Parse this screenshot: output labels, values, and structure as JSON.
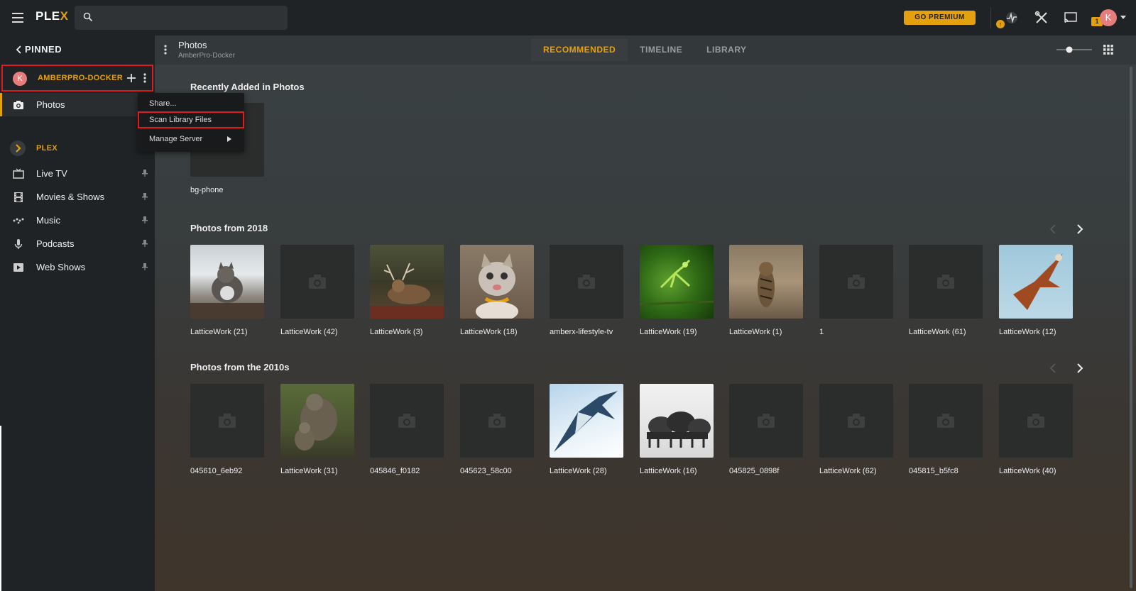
{
  "topbar": {
    "logo_main": "PLE",
    "logo_x": "X",
    "search_value": "",
    "search_placeholder": "",
    "premium_label": "GO PREMIUM",
    "notification_count": "1",
    "avatar_letter": "K",
    "brand_color": "#e5a00d",
    "icons": [
      "menu-icon",
      "search-icon",
      "activity-icon",
      "settings-icon",
      "cast-icon",
      "chevron-down-icon"
    ]
  },
  "sidebar": {
    "pinned_label": "PINNED",
    "server": {
      "avatar_letter": "K",
      "name": "AMBERPRO-DOCKER"
    },
    "libraries": [
      {
        "label": "Photos",
        "icon": "camera-icon",
        "active": true
      }
    ],
    "plex_label": "PLEX",
    "items": [
      {
        "label": "Live TV",
        "icon": "tv-icon"
      },
      {
        "label": "Movies & Shows",
        "icon": "film-icon"
      },
      {
        "label": "Music",
        "icon": "music-icon"
      },
      {
        "label": "Podcasts",
        "icon": "microphone-icon"
      },
      {
        "label": "Web Shows",
        "icon": "play-icon"
      }
    ]
  },
  "context_menu": {
    "items": [
      {
        "label": "Share..."
      },
      {
        "label": "Scan Library Files",
        "highlighted": true
      },
      {
        "label": "Manage Server",
        "has_submenu": true
      }
    ]
  },
  "main": {
    "header": {
      "title": "Photos",
      "subtitle": "AmberPro-Docker"
    },
    "tabs": [
      {
        "label": "RECOMMENDED",
        "active": true
      },
      {
        "label": "TIMELINE",
        "active": false
      },
      {
        "label": "LIBRARY",
        "active": false
      }
    ],
    "sections": [
      {
        "title": "Recently Added in Photos",
        "items": [
          {
            "label": "bg-phone",
            "image": "placeholder"
          }
        ]
      },
      {
        "title": "Photos from 2018",
        "items": [
          {
            "label": "LatticeWork (21)",
            "image": "cat-in-snow"
          },
          {
            "label": "LatticeWork (42)",
            "image": "placeholder"
          },
          {
            "label": "LatticeWork (3)",
            "image": "deer"
          },
          {
            "label": "LatticeWork (18)",
            "image": "kitten"
          },
          {
            "label": "amberx-lifestyle-tv",
            "image": "placeholder"
          },
          {
            "label": "LatticeWork (19)",
            "image": "mantis"
          },
          {
            "label": "LatticeWork (1)",
            "image": "tiger"
          },
          {
            "label": "1",
            "image": "placeholder"
          },
          {
            "label": "LatticeWork (61)",
            "image": "placeholder"
          },
          {
            "label": "LatticeWork (12)",
            "image": "kite-bird"
          }
        ]
      },
      {
        "title": "Photos from the 2010s",
        "items": [
          {
            "label": "045610_6eb92",
            "image": "placeholder"
          },
          {
            "label": "LatticeWork (31)",
            "image": "bears"
          },
          {
            "label": "045846_f0182",
            "image": "placeholder"
          },
          {
            "label": "045623_58c00",
            "image": "placeholder"
          },
          {
            "label": "LatticeWork (28)",
            "image": "shark"
          },
          {
            "label": "LatticeWork (16)",
            "image": "buffalo-snow"
          },
          {
            "label": "045825_0898f",
            "image": "placeholder"
          },
          {
            "label": "LatticeWork (62)",
            "image": "placeholder"
          },
          {
            "label": "045815_b5fc8",
            "image": "placeholder"
          },
          {
            "label": "LatticeWork (40)",
            "image": "placeholder"
          }
        ]
      }
    ]
  }
}
